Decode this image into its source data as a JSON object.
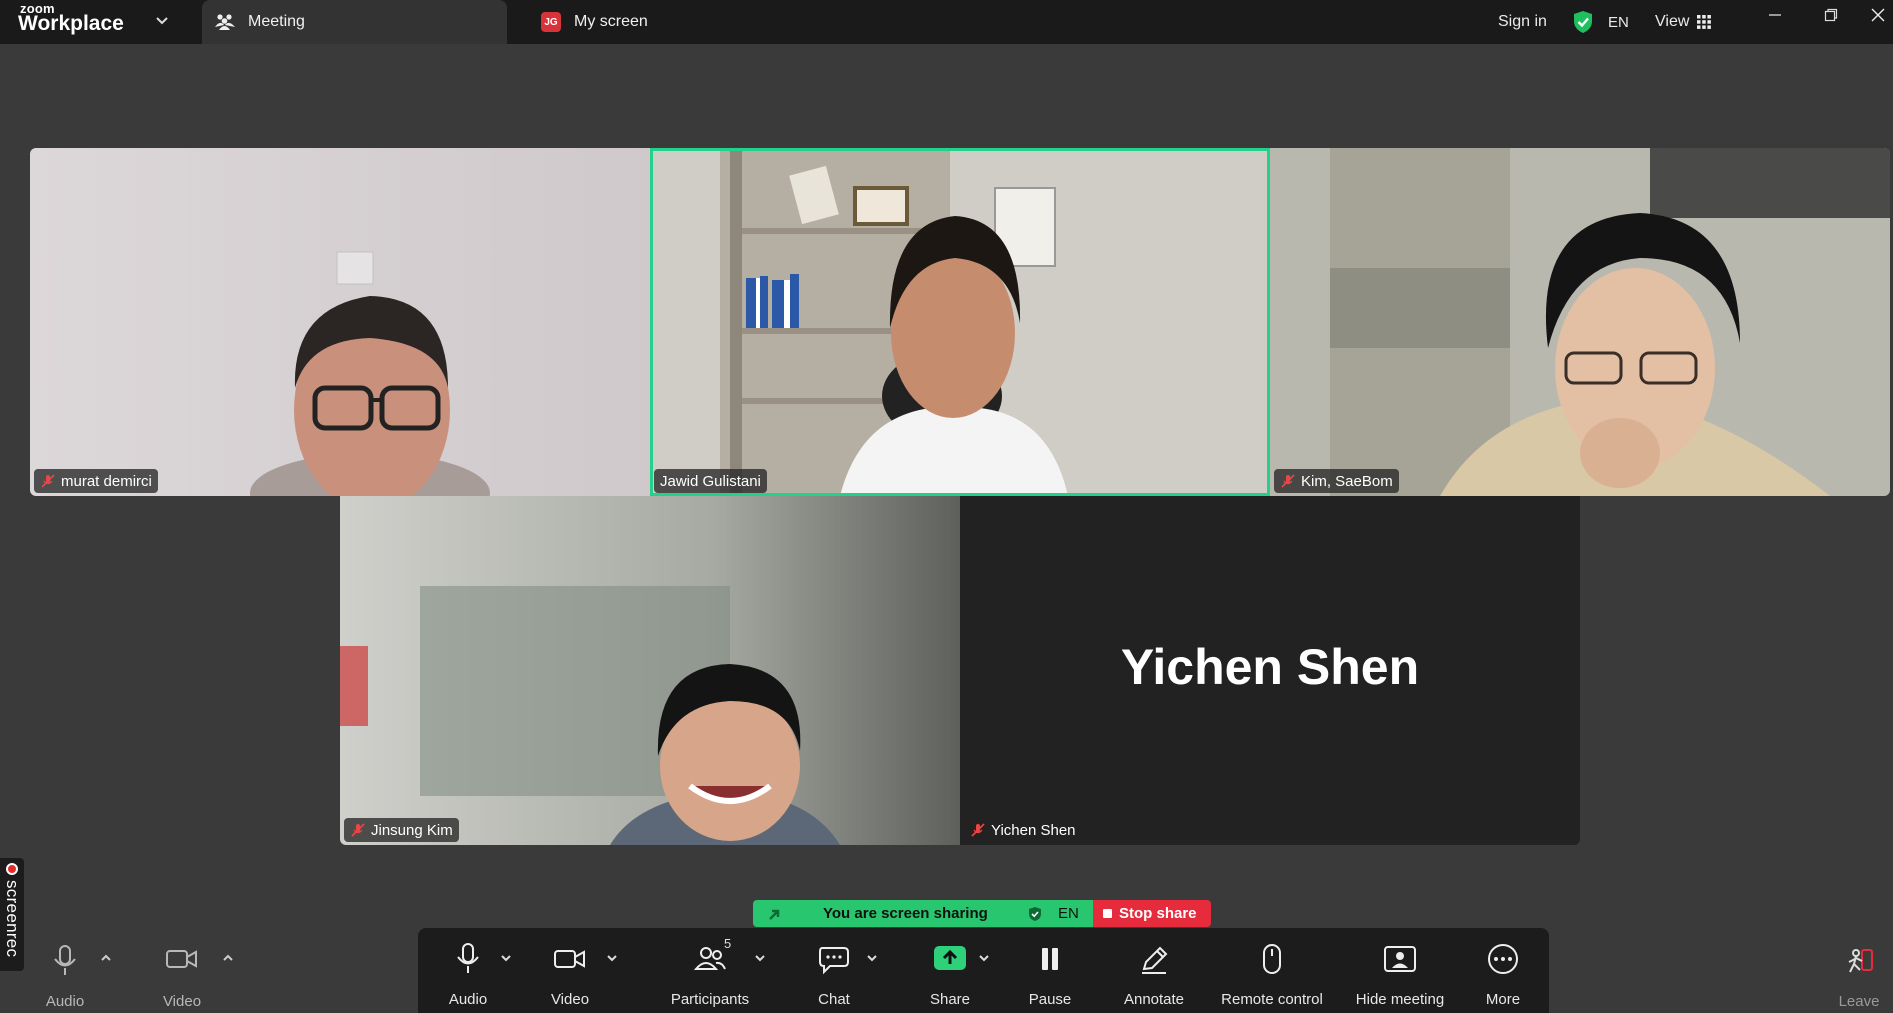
{
  "app": {
    "brand_top": "zoom",
    "brand_bottom": "Workplace"
  },
  "tabs": [
    {
      "label": "Meeting",
      "icon": "meeting-people-icon"
    },
    {
      "label": "My screen",
      "icon": "jg-badge-icon",
      "badge": "JG"
    }
  ],
  "titlebar_right": {
    "sign_in": "Sign in",
    "lang": "EN",
    "view": "View"
  },
  "participants": [
    {
      "name": "murat demirci",
      "muted": true
    },
    {
      "name": "Jawid Gulistani",
      "muted": false,
      "active_speaker": true
    },
    {
      "name": "Kim, SaeBom",
      "muted": true
    },
    {
      "name": "Jinsung Kim",
      "muted": true
    },
    {
      "name": "Yichen Shen",
      "muted": true,
      "video_off": true
    }
  ],
  "side_tab": {
    "label": "screenrec"
  },
  "share_banner": {
    "message": "You are screen sharing",
    "lang": "EN",
    "stop": "Stop share"
  },
  "left_controls": {
    "audio": "Audio",
    "video": "Video"
  },
  "toolbar": {
    "audio": "Audio",
    "video": "Video",
    "participants": "Participants",
    "participants_count": "5",
    "chat": "Chat",
    "share": "Share",
    "pause": "Pause",
    "annotate": "Annotate",
    "remote_control": "Remote control",
    "hide_meeting": "Hide meeting",
    "more": "More"
  },
  "leave": "Leave",
  "colors": {
    "active_speaker": "#23d18b",
    "share_green": "#28c76f",
    "stop_red": "#e52b3c",
    "toolbar_bg": "#1c1c1c",
    "stage_bg": "#3a3a3a"
  }
}
